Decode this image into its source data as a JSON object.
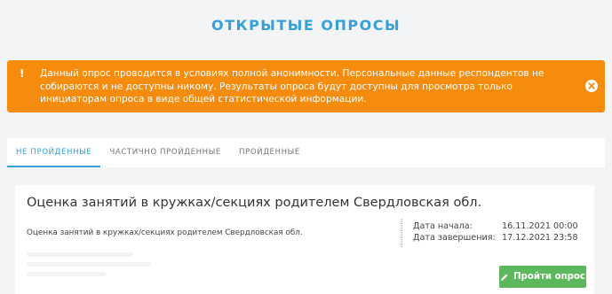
{
  "page": {
    "title": "ОТКРЫТЫЕ ОПРОСЫ"
  },
  "alert": {
    "icon": "warning-exclamation-icon",
    "text": "Данный опрос проводится в условиях полной анонимности. Персональные данные респондентов не собираются и не доступны никому. Результаты опроса будут доступны для просмотра только инициаторам опроса в виде общей статистической информации.",
    "close_icon": "close-circle-icon",
    "background": "#f58c0e"
  },
  "tabs": [
    {
      "label": "НЕ ПРОЙДЕННЫЕ",
      "active": true
    },
    {
      "label": "ЧАСТИЧНО ПРОЙДЕННЫЕ",
      "active": false
    },
    {
      "label": "ПРОЙДЕННЫЕ",
      "active": false
    }
  ],
  "survey": {
    "title": "Оценка занятий в кружках/секциях родителем Свердловская обл.",
    "description": "Оценка занятий в кружках/секциях родителем Свердловская обл.",
    "start_label": "Дата начала:",
    "start_value": "16.11.2021 00:00",
    "end_label": "Дата завершения:",
    "end_value": "17.12.2021 23:58",
    "button_label": "Пройти опрос",
    "button_icon": "pencil-icon",
    "button_color": "#5cb85c"
  },
  "colors": {
    "accent": "#35a0d9",
    "background": "#f2f4f6"
  }
}
